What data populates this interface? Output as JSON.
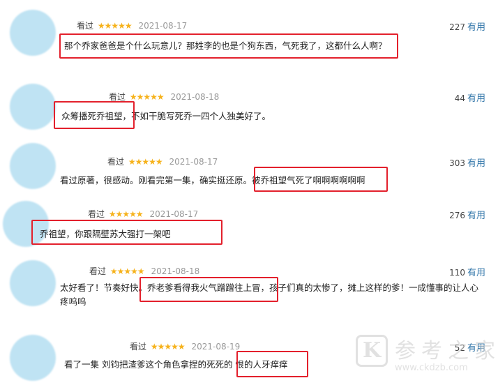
{
  "reviews": [
    {
      "status": "看过",
      "stars": "★★★★★",
      "date": "2021-08-17",
      "count": "227",
      "useful_label": "有用",
      "text": "那个乔家爸爸是个什么玩意儿？那姓李的也是个狗东西，气死我了，这都什么人啊？"
    },
    {
      "status": "看过",
      "stars": "★★★★★",
      "date": "2021-08-18",
      "count": "44",
      "useful_label": "有用",
      "text": "众筹播死乔祖望，不如干脆写死乔一四个人独美好了。"
    },
    {
      "status": "看过",
      "stars": "★★★★★",
      "date": "2021-08-17",
      "count": "303",
      "useful_label": "有用",
      "text": "看过原著，很感动。刚看完第一集，确实挺还原。被乔祖望气死了啊啊啊啊啊啊"
    },
    {
      "status": "看过",
      "stars": "★★★★★",
      "date": "2021-08-17",
      "count": "276",
      "useful_label": "有用",
      "text": "乔祖望，你跟隔壁苏大强打一架吧"
    },
    {
      "status": "看过",
      "stars": "★★★★★",
      "date": "2021-08-18",
      "count": "110",
      "useful_label": "有用",
      "text": "太好看了！节奏好快。乔老爹看得我火气蹭蹭往上冒，孩子们真的太惨了，摊上这样的爹！一成懂事的让人心疼呜呜"
    },
    {
      "status": "看过",
      "stars": "★★★★★",
      "date": "2021-08-19",
      "count": "52",
      "useful_label": "有用",
      "text": "看了一集 刘钧把渣爹这个角色拿捏的死死的 恨的人牙痒痒"
    }
  ],
  "watermark": {
    "logo_letter": "K",
    "brand": "参考之家",
    "url": "www.ckdzb.com"
  }
}
